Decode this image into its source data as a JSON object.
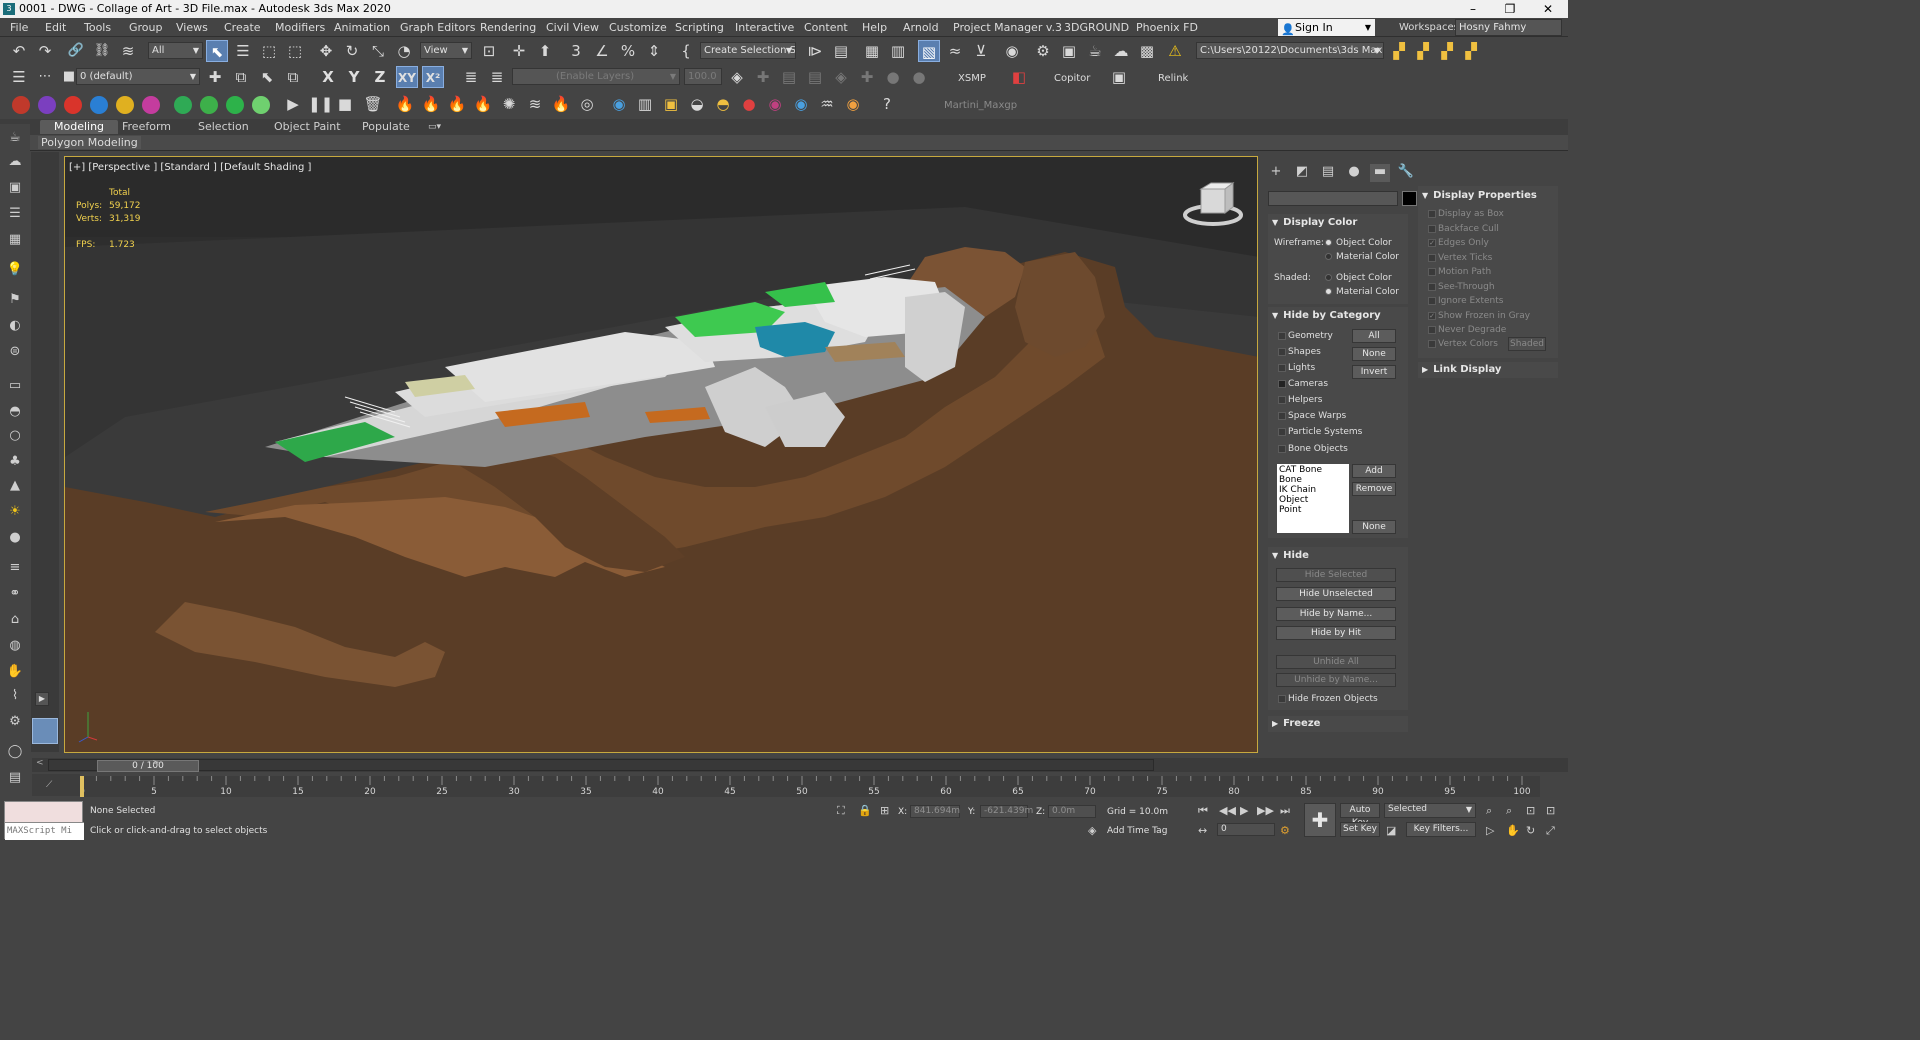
{
  "window": {
    "title": "0001 - DWG - Collage of Art - 3D File.max - Autodesk 3ds Max 2020",
    "app_icon": "3ds-max-icon",
    "minimize": "–",
    "maximize": "❐",
    "close": "✕"
  },
  "menu": {
    "items": [
      "File",
      "Edit",
      "Tools",
      "Group",
      "Views",
      "Create",
      "Modifiers",
      "Animation",
      "Graph Editors",
      "Rendering",
      "Civil View",
      "Customize",
      "Scripting",
      "Interactive",
      "Content",
      "Help",
      "Arnold",
      "Project Manager v.3",
      "3DGROUND",
      "Phoenix FD"
    ],
    "sign_in": "Sign In",
    "workspaces_label": "Workspaces:",
    "workspace_value": "Hosny Fahmy"
  },
  "toolbar1": {
    "selection_filter": "All",
    "ref_coord": "View",
    "named_selection": "Create Selection Se",
    "project_path": "C:\\Users\\20122\\Documents\\3ds Max 2020"
  },
  "toolbar2": {
    "layer": "0 (default)",
    "axis_x": "X",
    "axis_y": "Y",
    "axis_z": "Z",
    "axis_xy": "XY",
    "axis_xy2": "X²",
    "enable_layers": "(Enable Layers)",
    "spinner": "100.0",
    "xsmp": "XSMP",
    "copitor": "Copitor",
    "relink": "Relink"
  },
  "toolbar3": {
    "plugin_label": "Martini_Maxgp",
    "colors": [
      "#c0392b",
      "#7b3fbf",
      "#d9342b",
      "#2a7fd4",
      "#e0b020",
      "#c43c9e",
      "#2faa55",
      "#3db04a",
      "#2db24a",
      "#6fd06f"
    ]
  },
  "ribbon": {
    "tabs": [
      "Modeling",
      "Freeform",
      "Selection",
      "Object Paint",
      "Populate"
    ],
    "active_tab": "Modeling",
    "subpanel": "Polygon Modeling"
  },
  "viewport": {
    "label": "[+] [Perspective ] [Standard ] [Default Shading ]",
    "stats_header": "Total",
    "polys_label": "Polys:",
    "polys_value": "59,172",
    "verts_label": "Verts:",
    "verts_value": "31,319",
    "fps_label": "FPS:",
    "fps_value": "1.723"
  },
  "command_panel": {
    "display_color": {
      "title": "Display Color",
      "wireframe_label": "Wireframe:",
      "shaded_label": "Shaded:",
      "object_color": "Object Color",
      "material_color": "Material Color",
      "wireframe_selected": "Object Color",
      "shaded_selected": "Material Color"
    },
    "hide_by_category": {
      "title": "Hide by Category",
      "items": [
        "Geometry",
        "Shapes",
        "Lights",
        "Cameras",
        "Helpers",
        "Space Warps",
        "Particle Systems",
        "Bone Objects"
      ],
      "btn_all": "All",
      "btn_none": "None",
      "btn_invert": "Invert",
      "list": [
        "CAT Bone",
        "Bone",
        "IK Chain Object",
        "Point"
      ],
      "btn_add": "Add",
      "btn_remove": "Remove",
      "btn_none2": "None"
    },
    "hide": {
      "title": "Hide",
      "hide_selected": "Hide Selected",
      "hide_unselected": "Hide Unselected",
      "hide_by_name": "Hide by Name...",
      "hide_by_hit": "Hide by Hit",
      "unhide_all": "Unhide All",
      "unhide_by_name": "Unhide by Name...",
      "hide_frozen": "Hide Frozen Objects"
    },
    "freeze": {
      "title": "Freeze"
    },
    "display_properties": {
      "title": "Display Properties",
      "items": [
        "Display as Box",
        "Backface Cull",
        "Edges Only",
        "Vertex Ticks",
        "Motion Path",
        "See-Through",
        "Ignore Extents",
        "Show Frozen in Gray",
        "Never Degrade",
        "Vertex Colors"
      ],
      "checked": [
        "Edges Only",
        "Show Frozen in Gray"
      ],
      "shaded_btn": "Shaded"
    },
    "link_display": {
      "title": "Link Display"
    }
  },
  "timeline": {
    "frame_display": "0 / 100",
    "ticks": [
      "0",
      "5",
      "10",
      "15",
      "20",
      "25",
      "30",
      "35",
      "40",
      "45",
      "50",
      "55",
      "60",
      "65",
      "70",
      "75",
      "80",
      "85",
      "90",
      "95",
      "100"
    ]
  },
  "status": {
    "maxscript": "MAXScript Mi",
    "selection": "None Selected",
    "prompt": "Click or click-and-drag to select objects",
    "x_label": "X:",
    "x_value": "841.694m",
    "y_label": "Y:",
    "y_value": "-621.439m",
    "z_label": "Z:",
    "z_value": "0.0m",
    "grid": "Grid = 10.0m",
    "add_time_tag": "Add Time Tag",
    "auto_key": "Auto Key",
    "set_key": "Set Key",
    "selected_dropdown": "Selected",
    "key_filters": "Key Filters...",
    "frame_field": "0"
  }
}
